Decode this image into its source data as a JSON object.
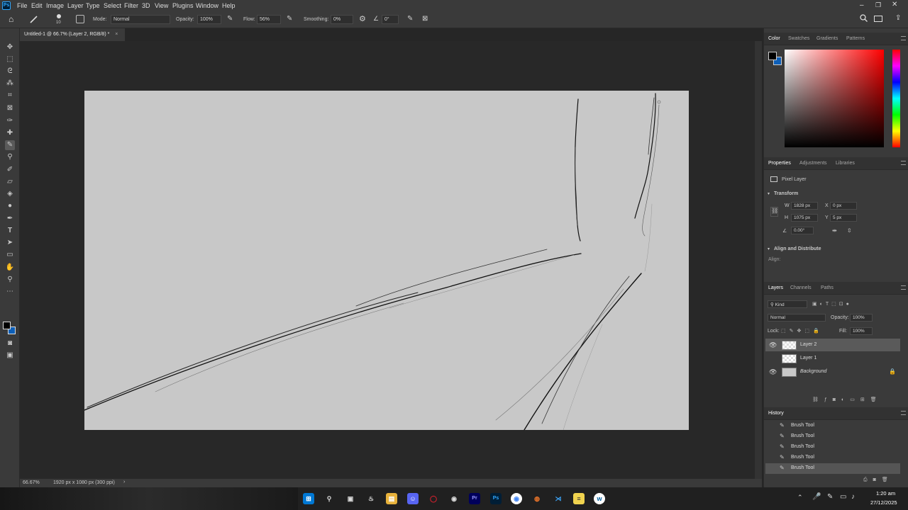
{
  "app": {
    "logo": "Ps"
  },
  "menu": [
    "File",
    "Edit",
    "Image",
    "Layer",
    "Type",
    "Select",
    "Filter",
    "3D",
    "View",
    "Plugins",
    "Window",
    "Help"
  ],
  "options": {
    "brush_size": "10",
    "mode_label": "Mode:",
    "mode_value": "Normal",
    "opacity_label": "Opacity:",
    "opacity_value": "100%",
    "flow_label": "Flow:",
    "flow_value": "56%",
    "smoothing_label": "Smoothing:",
    "smoothing_value": "0%",
    "angle_value": "0°"
  },
  "document_tab": {
    "title": "Untitled-1 @ 66.7% (Layer 2, RGB/8) *",
    "close": "×"
  },
  "status": {
    "zoom": "66.67%",
    "info": "1920 px x 1080 px (300 ppi)",
    "arrow": "›"
  },
  "color_panel": {
    "tabs": [
      "Color",
      "Swatches",
      "Gradients",
      "Patterns"
    ],
    "active_tab": "Color",
    "foreground": "#000000",
    "background": "#0d5fb8",
    "hue": "#ff0000"
  },
  "properties_panel": {
    "tabs": [
      "Properties",
      "Adjustments",
      "Libraries"
    ],
    "active_tab": "Properties",
    "layer_type": "Pixel Layer",
    "transform_title": "Transform",
    "w_label": "W",
    "w_value": "1828 px",
    "h_label": "H",
    "h_value": "1075 px",
    "x_label": "X",
    "x_value": "0 px",
    "y_label": "Y",
    "y_value": "5 px",
    "angle_value": "0.00°",
    "align_title": "Align and Distribute",
    "align_label": "Align:"
  },
  "layers_panel": {
    "tabs": [
      "Layers",
      "Channels",
      "Paths"
    ],
    "active_tab": "Layers",
    "kind_label": "Kind",
    "blend_mode": "Normal",
    "opacity_label": "Opacity:",
    "opacity_value": "100%",
    "lock_label": "Lock:",
    "fill_label": "Fill:",
    "fill_value": "100%",
    "layers": [
      {
        "name": "Layer 2",
        "visible": true,
        "selected": true
      },
      {
        "name": "Layer 1",
        "visible": false,
        "selected": false
      },
      {
        "name": "Background",
        "visible": true,
        "selected": false,
        "locked": true
      }
    ]
  },
  "history_panel": {
    "title": "History",
    "items": [
      "Brush Tool",
      "Brush Tool",
      "Brush Tool",
      "Brush Tool",
      "Brush Tool"
    ]
  },
  "tools": [
    "move-tool",
    "marquee-tool",
    "lasso-tool",
    "magic-wand-tool",
    "crop-tool",
    "frame-tool",
    "eyedropper-tool",
    "healing-tool",
    "brush-tool",
    "stamp-tool",
    "history-brush-tool",
    "eraser-tool",
    "bucket-tool",
    "dodge-tool",
    "pen-tool",
    "type-tool",
    "path-select-tool",
    "rectangle-tool",
    "hand-tool",
    "zoom-tool",
    "more-tools"
  ],
  "taskbar": {
    "time": "1:20 am",
    "date": "27/12/2025",
    "apps": [
      "start",
      "search",
      "task-view",
      "steam",
      "explorer",
      "discord",
      "opera",
      "obs",
      "premiere",
      "photoshop",
      "chrome",
      "blender",
      "vscode",
      "notepad",
      "wacom"
    ]
  }
}
